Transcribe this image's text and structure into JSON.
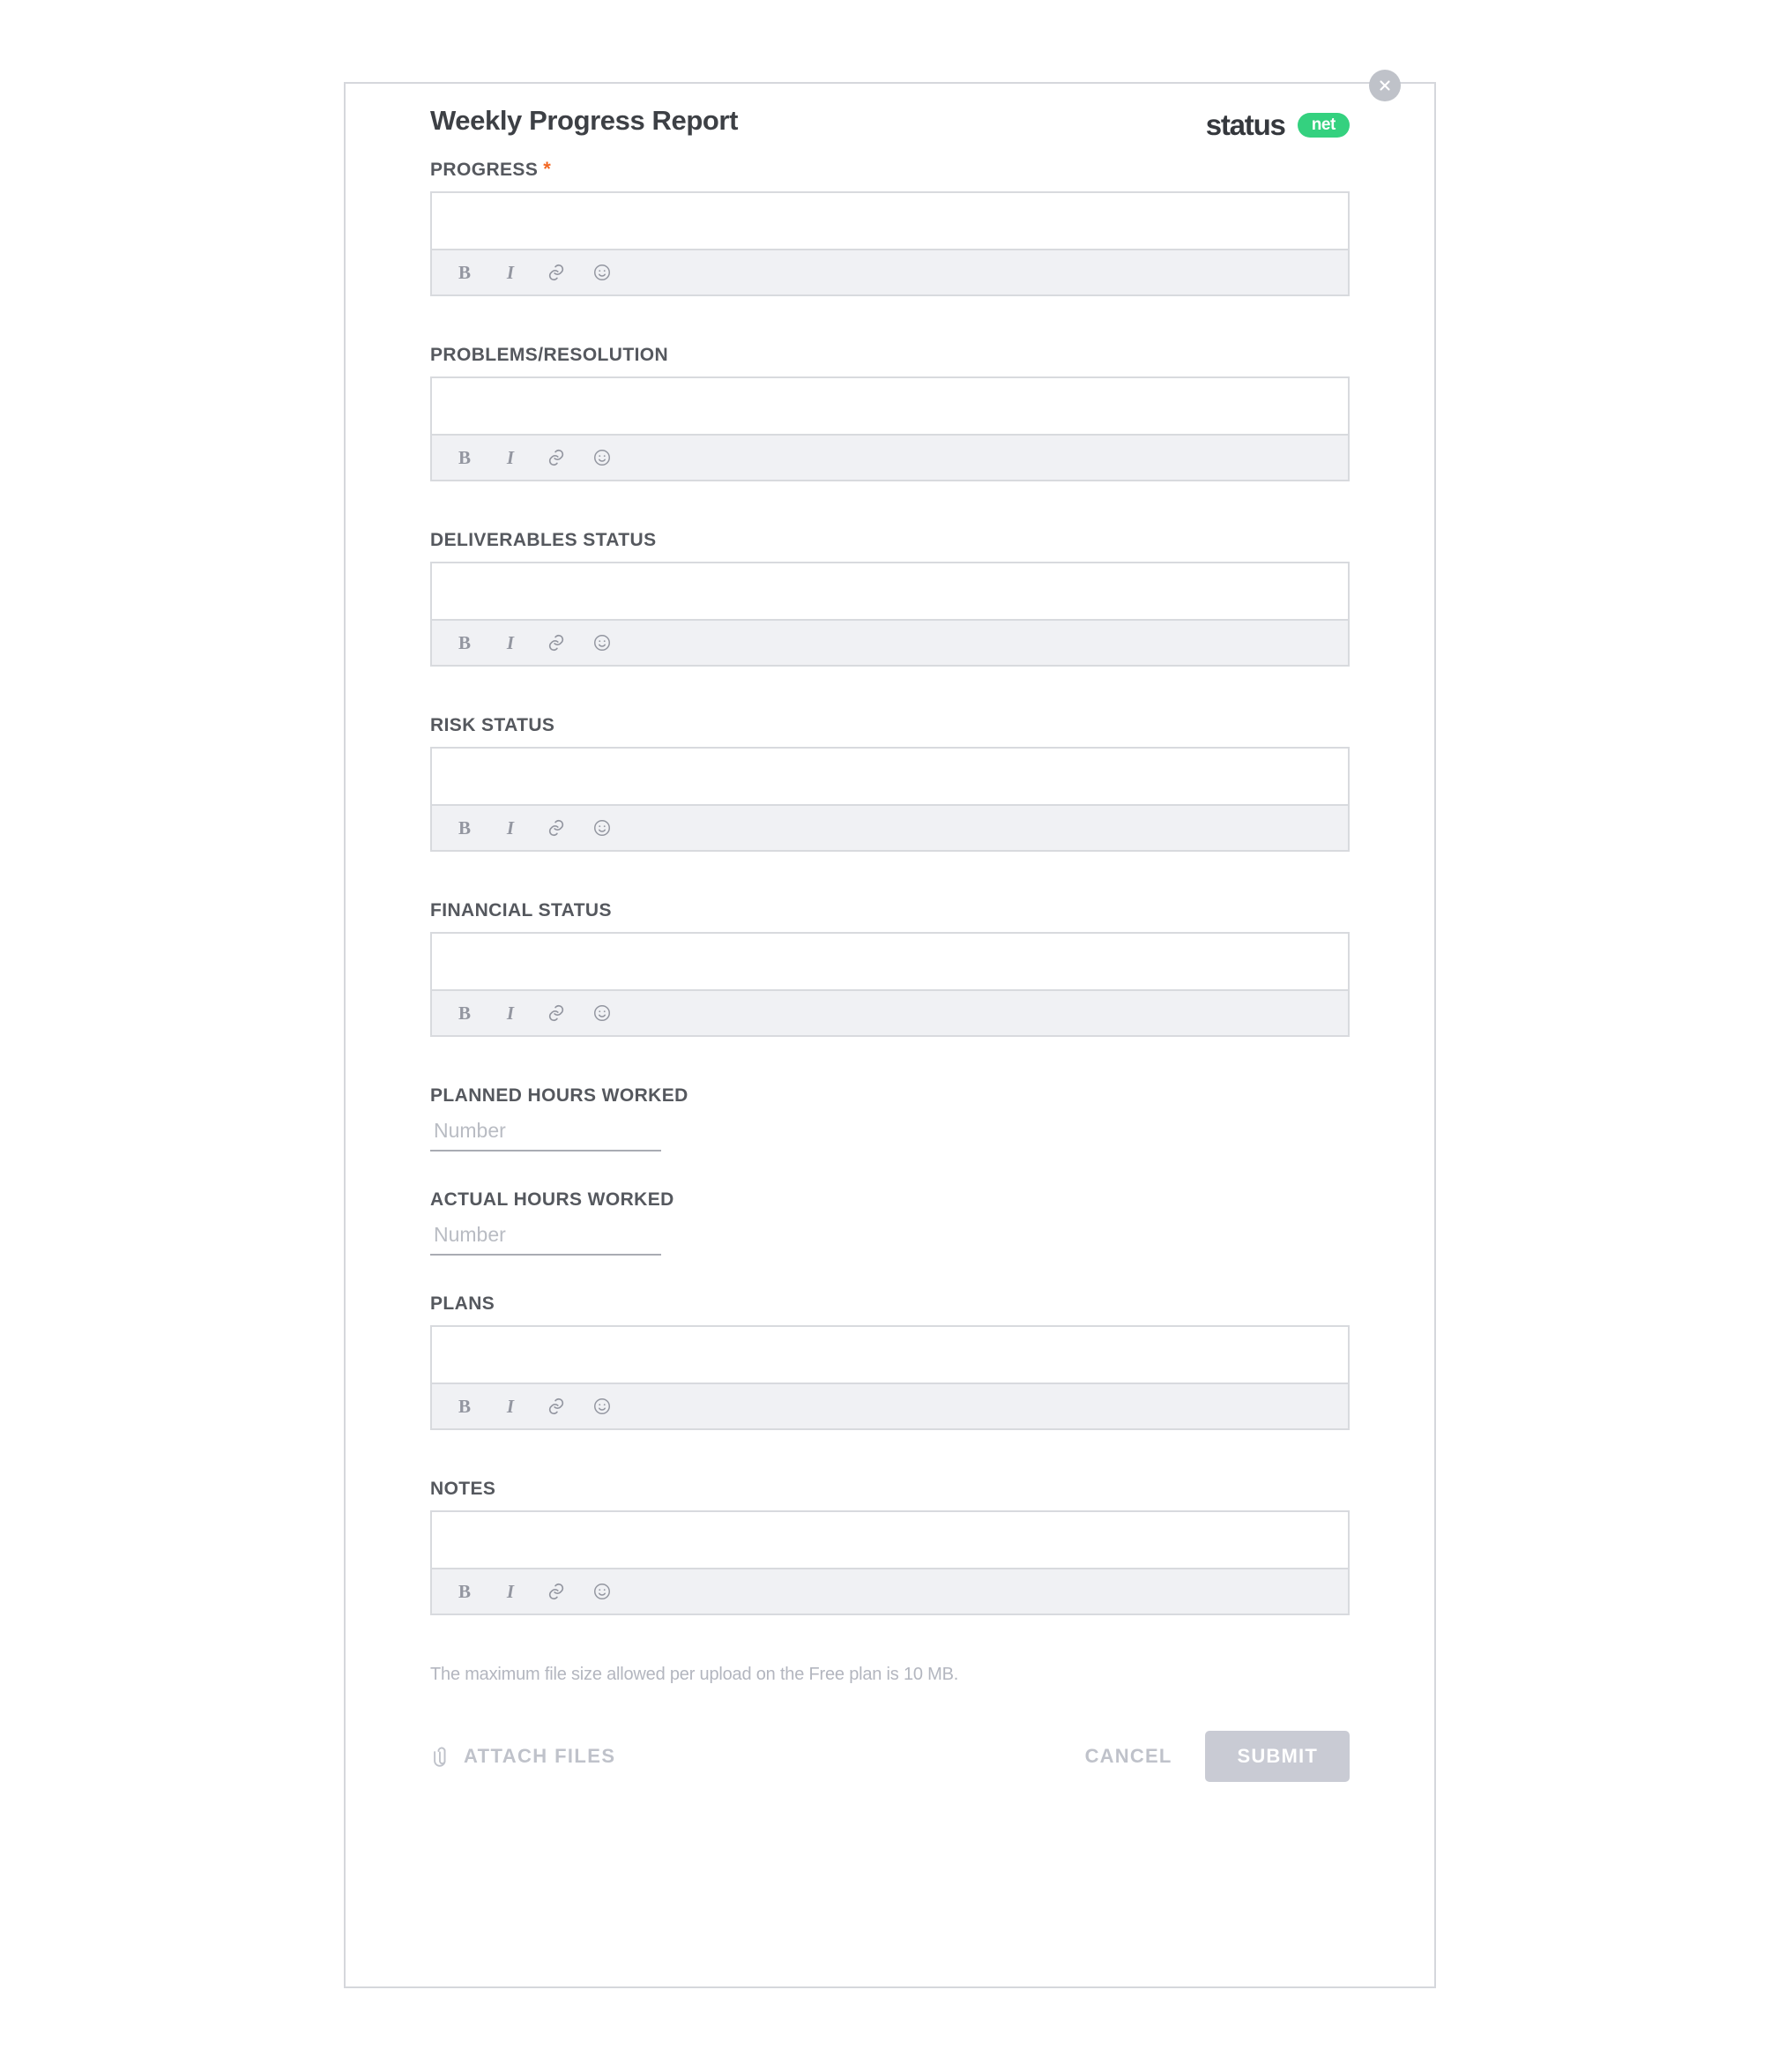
{
  "header": {
    "title": "Weekly Progress Report",
    "brand_name": "status",
    "brand_badge": "net",
    "close_icon": "close-icon"
  },
  "toolbar": {
    "bold": "B",
    "italic": "I",
    "link_icon": "link-icon",
    "emoji_icon": "emoji-icon"
  },
  "fields": [
    {
      "label": "PROGRESS",
      "required": true,
      "type": "richtext",
      "value": ""
    },
    {
      "label": "PROBLEMS/RESOLUTION",
      "required": false,
      "type": "richtext",
      "value": ""
    },
    {
      "label": "DELIVERABLES STATUS",
      "required": false,
      "type": "richtext",
      "value": ""
    },
    {
      "label": "RISK STATUS",
      "required": false,
      "type": "richtext",
      "value": ""
    },
    {
      "label": "FINANCIAL STATUS",
      "required": false,
      "type": "richtext",
      "value": ""
    },
    {
      "label": "PLANNED HOURS WORKED",
      "required": false,
      "type": "number",
      "value": "",
      "placeholder": "Number"
    },
    {
      "label": "ACTUAL HOURS WORKED",
      "required": false,
      "type": "number",
      "value": "",
      "placeholder": "Number"
    },
    {
      "label": "PLANS",
      "required": false,
      "type": "richtext",
      "value": ""
    },
    {
      "label": "NOTES",
      "required": false,
      "type": "richtext",
      "value": ""
    }
  ],
  "footer": {
    "file_note": "The maximum file size allowed per upload on the Free plan is 10 MB.",
    "attach_label": "ATTACH FILES",
    "attach_icon": "paperclip-icon",
    "cancel_label": "CANCEL",
    "submit_label": "SUBMIT"
  },
  "colors": {
    "required_star": "#f26722",
    "brand_green": "#34d17f",
    "submit_disabled": "#c9cbd4",
    "label_text": "#55585e"
  }
}
